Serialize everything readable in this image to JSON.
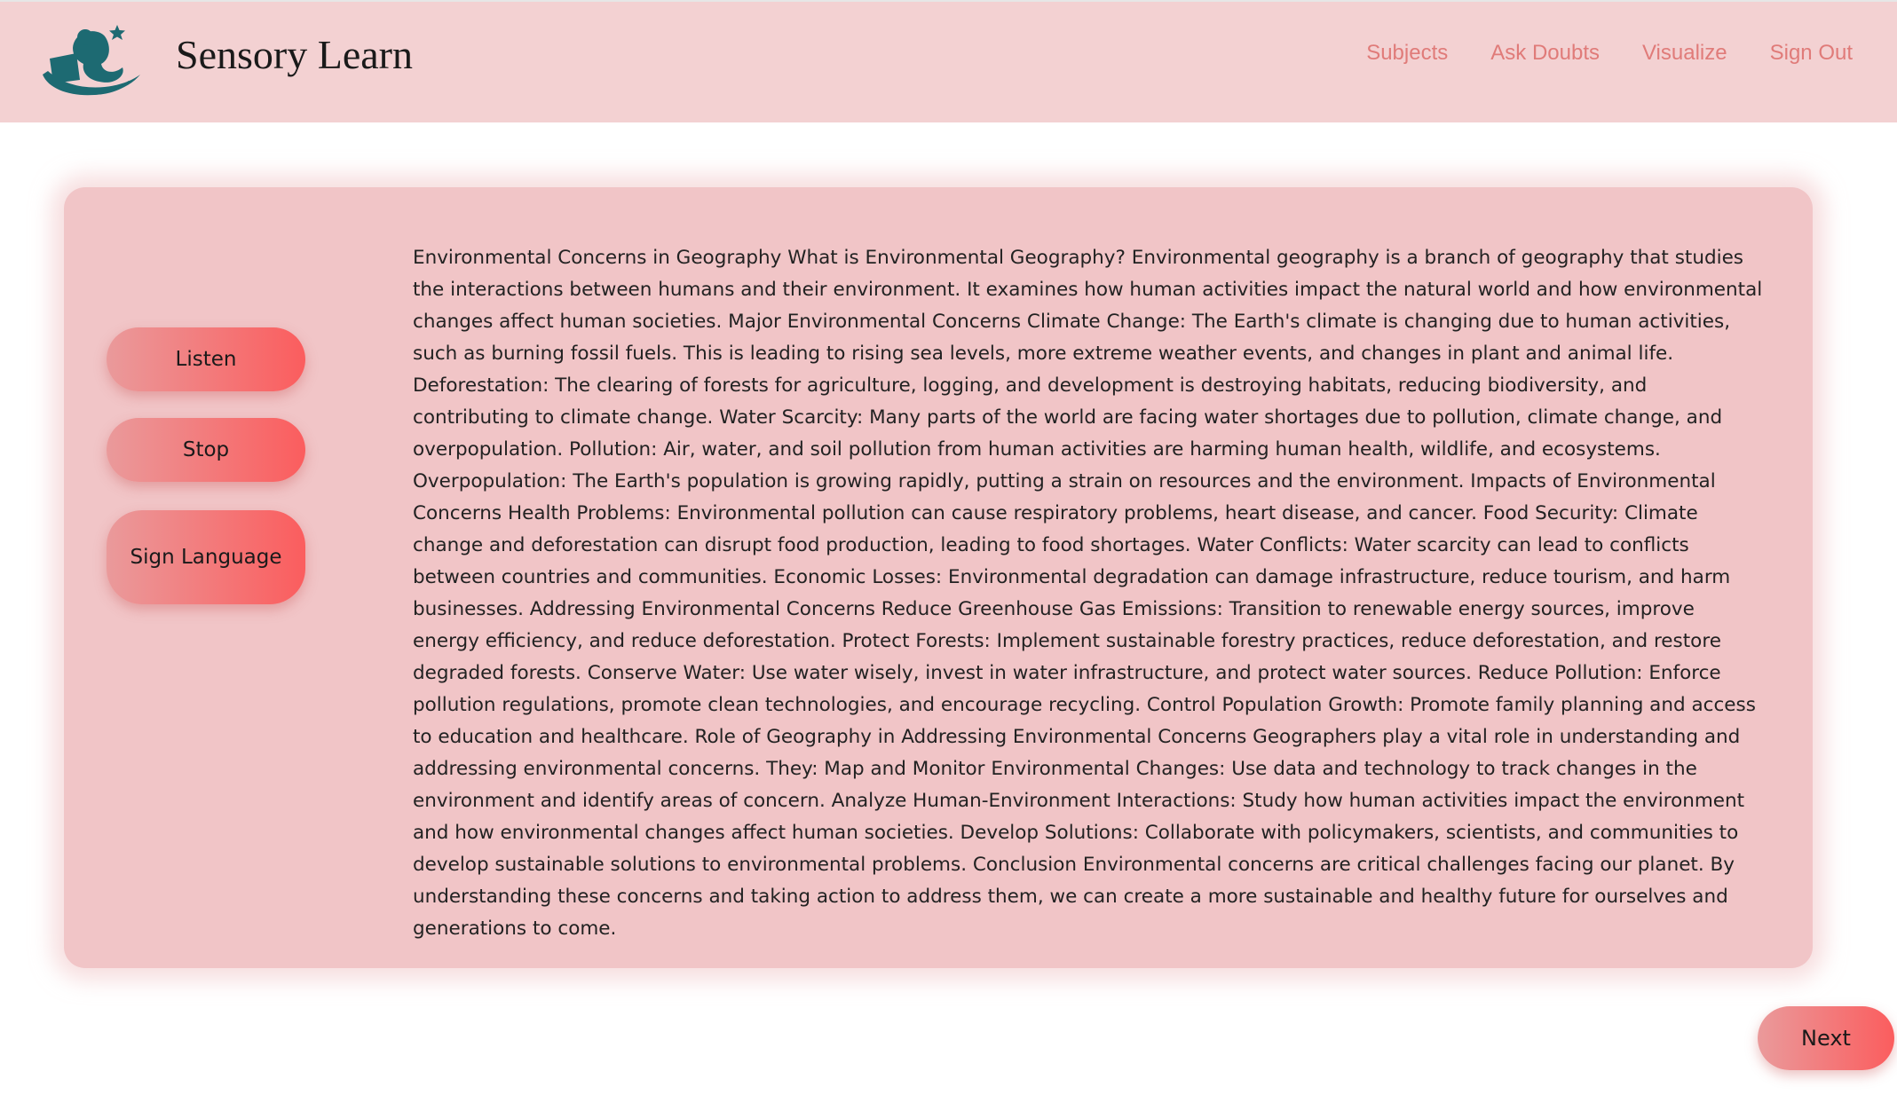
{
  "header": {
    "brand": "Sensory Learn",
    "logo_icon": "reading-student-logo",
    "nav": [
      "Subjects",
      "Ask Doubts",
      "Visualize",
      "Sign Out"
    ]
  },
  "controls": {
    "listen_label": "Listen",
    "stop_label": "Stop",
    "sign_language_label": "Sign Language"
  },
  "content": {
    "text": "Environmental Concerns in Geography What is Environmental Geography? Environmental geography is a branch of geography that studies the interactions between humans and their environment. It examines how human activities impact the natural world and how environmental changes affect human societies. Major Environmental Concerns Climate Change: The Earth's climate is changing due to human activities, such as burning fossil fuels. This is leading to rising sea levels, more extreme weather events, and changes in plant and animal life. Deforestation: The clearing of forests for agriculture, logging, and development is destroying habitats, reducing biodiversity, and contributing to climate change. Water Scarcity: Many parts of the world are facing water shortages due to pollution, climate change, and overpopulation. Pollution: Air, water, and soil pollution from human activities are harming human health, wildlife, and ecosystems. Overpopulation: The Earth's population is growing rapidly, putting a strain on resources and the environment. Impacts of Environmental Concerns Health Problems: Environmental pollution can cause respiratory problems, heart disease, and cancer. Food Security: Climate change and deforestation can disrupt food production, leading to food shortages. Water Conflicts: Water scarcity can lead to conflicts between countries and communities. Economic Losses: Environmental degradation can damage infrastructure, reduce tourism, and harm businesses. Addressing Environmental Concerns Reduce Greenhouse Gas Emissions: Transition to renewable energy sources, improve energy efficiency, and reduce deforestation. Protect Forests: Implement sustainable forestry practices, reduce deforestation, and restore degraded forests. Conserve Water: Use water wisely, invest in water infrastructure, and protect water sources. Reduce Pollution: Enforce pollution regulations, promote clean technologies, and encourage recycling. Control Population Growth: Promote family planning and access to education and healthcare. Role of Geography in Addressing Environmental Concerns Geographers play a vital role in understanding and addressing environmental concerns. They: Map and Monitor Environmental Changes: Use data and technology to track changes in the environment and identify areas of concern. Analyze Human-Environment Interactions: Study how human activities impact the environment and how environmental changes affect human societies. Develop Solutions: Collaborate with policymakers, scientists, and communities to develop sustainable solutions to environmental problems. Conclusion Environmental concerns are critical challenges facing our planet. By understanding these concerns and taking action to address them, we can create a more sustainable and healthy future for ourselves and generations to come."
  },
  "footer": {
    "next_label": "Next"
  },
  "colors": {
    "navbar_bg": "#f3d1d2",
    "nav_link": "#e07b79",
    "card_bg": "#f1c5c7",
    "button_gradient_start": "#ea9a9b",
    "button_gradient_end": "#fb5d5e",
    "logo_teal": "#1d6a72"
  }
}
